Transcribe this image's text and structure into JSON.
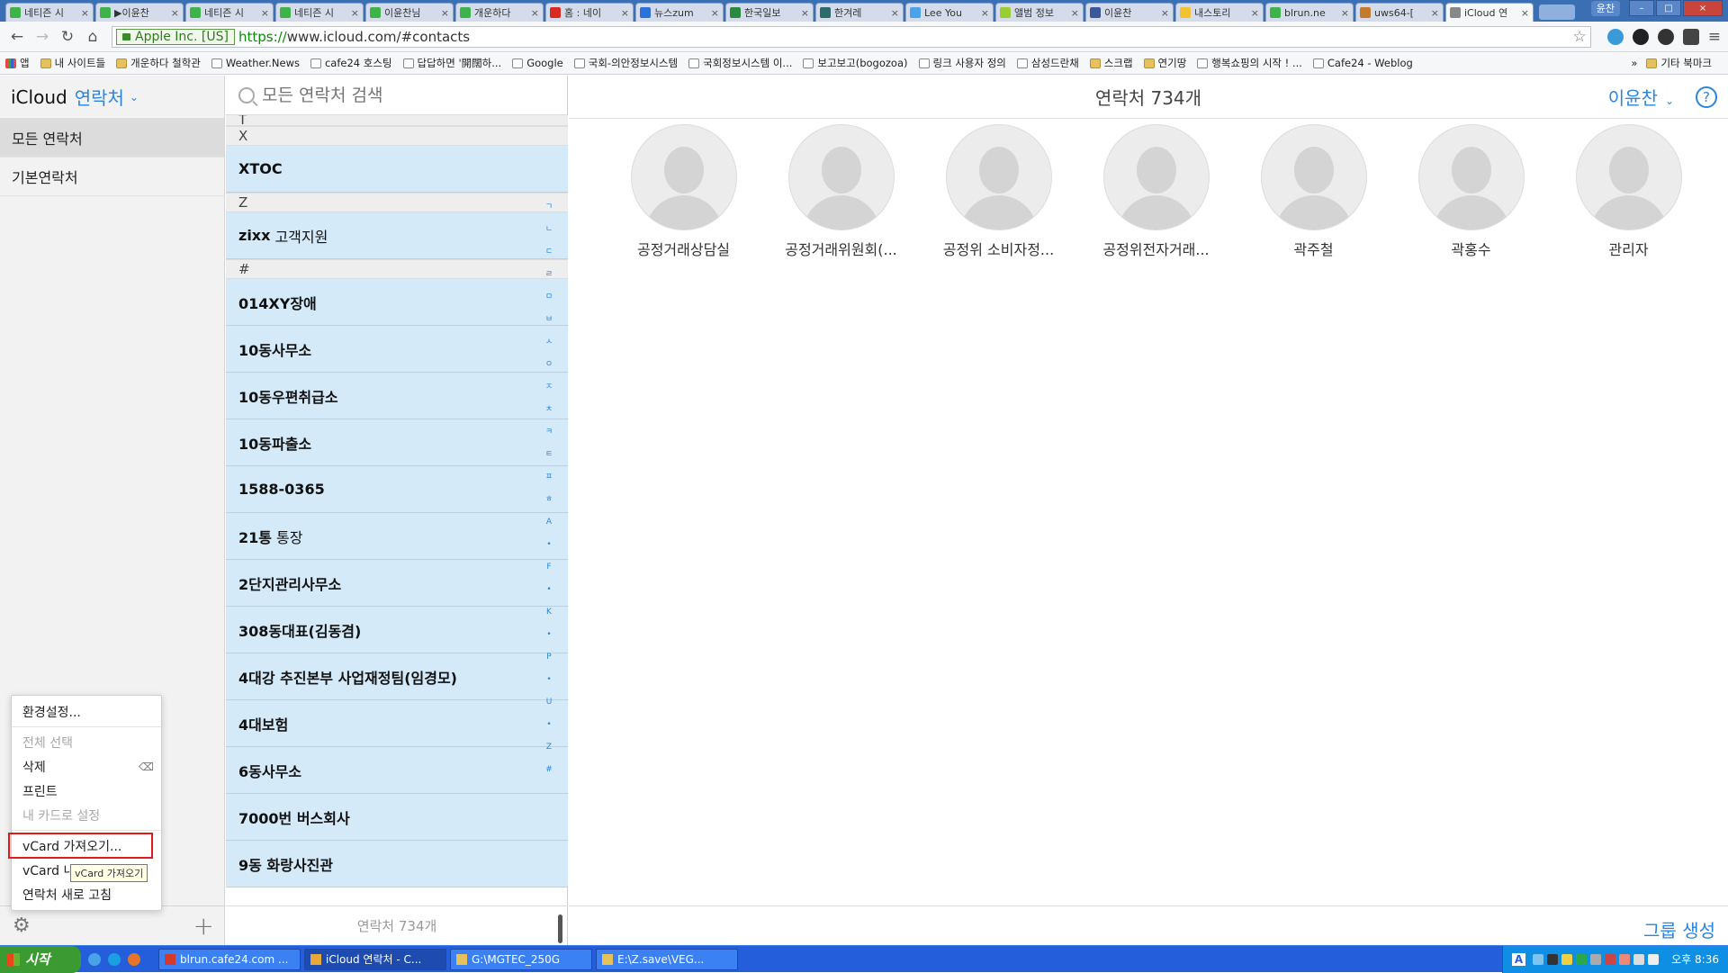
{
  "browser": {
    "tabs": [
      {
        "title": "네티즌 시",
        "color": "#3db34a",
        "active": false
      },
      {
        "title": "▶이윤찬",
        "color": "#3db34a",
        "active": false
      },
      {
        "title": "네티즌 시",
        "color": "#3db34a",
        "active": false
      },
      {
        "title": "네티즌 시",
        "color": "#3db34a",
        "active": false
      },
      {
        "title": "이윤찬님",
        "color": "#3db34a",
        "active": false
      },
      {
        "title": "개운하다",
        "color": "#3db34a",
        "active": false
      },
      {
        "title": "홈 : 네이",
        "color": "#d82a20",
        "active": false
      },
      {
        "title": "뉴스zum",
        "color": "#2b72d9",
        "active": false
      },
      {
        "title": "한국일보",
        "color": "#2a8a3e",
        "active": false
      },
      {
        "title": "한겨레",
        "color": "#2c6b6b",
        "active": false
      },
      {
        "title": "Lee You",
        "color": "#4aa3e8",
        "active": false
      },
      {
        "title": "앨범 정보",
        "color": "#9acd32",
        "active": false
      },
      {
        "title": "이윤찬",
        "color": "#3b5998",
        "active": false
      },
      {
        "title": "내스토리",
        "color": "#f2c230",
        "active": false
      },
      {
        "title": "blrun.ne",
        "color": "#3db34a",
        "active": false
      },
      {
        "title": "uws64-[",
        "color": "#c47a2c",
        "active": false
      },
      {
        "title": "iCloud 연",
        "color": "#888888",
        "active": true
      }
    ],
    "user_badge": "윤찬",
    "url": {
      "ev_label": "Apple Inc. [US]",
      "scheme": "https://",
      "rest": "www.icloud.com/#contacts"
    },
    "bookmarks": [
      {
        "label": "앱",
        "kind": "apps"
      },
      {
        "label": "내 사이트들",
        "kind": "folder"
      },
      {
        "label": "개운하다 철학관",
        "kind": "folder"
      },
      {
        "label": "Weather.News",
        "kind": "page"
      },
      {
        "label": "cafe24 호스팅",
        "kind": "page"
      },
      {
        "label": "답답하면 '開闊하...",
        "kind": "page"
      },
      {
        "label": "Google",
        "kind": "page"
      },
      {
        "label": "국회-의안정보시스템",
        "kind": "page"
      },
      {
        "label": "국회정보시스템 이...",
        "kind": "page"
      },
      {
        "label": "보고보고(bogozoa)",
        "kind": "page"
      },
      {
        "label": "링크 사용자 정의",
        "kind": "page"
      },
      {
        "label": "삼성드란채",
        "kind": "page"
      },
      {
        "label": "스크랩",
        "kind": "folder"
      },
      {
        "label": "연기땅",
        "kind": "folder"
      },
      {
        "label": "행복쇼핑의 시작 ! ...",
        "kind": "page"
      },
      {
        "label": "Cafe24 - Weblog",
        "kind": "page"
      }
    ],
    "bookmarks_more": "»",
    "other_bookmarks": "기타 북마크"
  },
  "sidebar": {
    "brand": "iCloud",
    "app": "연락처",
    "groups": [
      {
        "label": "모든 연락처",
        "selected": true
      },
      {
        "label": "기본연락처",
        "selected": false
      }
    ]
  },
  "menu": {
    "preferences": "환경설정...",
    "select_all": "전체 선택",
    "delete": "삭제",
    "delete_key": "⌫",
    "print": "프린트",
    "make_my_card": "내 카드로 설정",
    "import_vcard": "vCard 가져오기...",
    "export_vcard": "vCard 내보내기...",
    "refresh": "연락처 새로 고침",
    "tooltip": "vCard 가져오기"
  },
  "list": {
    "search_placeholder": "모든 연락처 검색",
    "top_partial_letter": "T",
    "sections": [
      {
        "letter": "X",
        "rows": [
          {
            "bold": "XTOC",
            "rest": ""
          }
        ]
      },
      {
        "letter": "Z",
        "rows": [
          {
            "bold": "zixx",
            "rest": "고객지원"
          }
        ]
      },
      {
        "letter": "#",
        "rows": [
          {
            "bold": "014XY장애",
            "rest": ""
          },
          {
            "bold": "10동사무소",
            "rest": ""
          },
          {
            "bold": "10동우편취급소",
            "rest": ""
          },
          {
            "bold": "10동파출소",
            "rest": ""
          },
          {
            "bold": "1588-0365",
            "rest": ""
          },
          {
            "bold": "21통",
            "rest": "통장"
          },
          {
            "bold": "2단지관리사무소",
            "rest": ""
          },
          {
            "bold": "308동대표(김동겸)",
            "rest": ""
          },
          {
            "bold": "4대강 추진본부 사업재정팀(임경모)",
            "rest": ""
          },
          {
            "bold": "4대보험",
            "rest": ""
          },
          {
            "bold": "6동사무소",
            "rest": ""
          },
          {
            "bold": "7000번 버스회사",
            "rest": ""
          },
          {
            "bold": "9동 화랑사진관",
            "rest": ""
          }
        ]
      }
    ],
    "index": [
      "ㄱ",
      "ㄴ",
      "ㄷ",
      "ㄹ",
      "ㅁ",
      "ㅂ",
      "ㅅ",
      "ㅇ",
      "ㅈ",
      "ㅊ",
      "ㅋ",
      "ㅌ",
      "ㅍ",
      "ㅎ",
      "A",
      "•",
      "F",
      "•",
      "K",
      "•",
      "P",
      "•",
      "U",
      "•",
      "Z",
      "#"
    ],
    "footer_count": "연락처 734개"
  },
  "main": {
    "header_count": "연락처 734개",
    "user_name": "이윤찬",
    "help": "?",
    "cards": [
      "공정거래상담실",
      "공정거래위원회(...",
      "공정위 소비자정...",
      "공정위전자거래...",
      "곽주철",
      "곽홍수",
      "관리자"
    ],
    "new_group": "그룹 생성"
  },
  "taskbar": {
    "start": "시작",
    "tasks": [
      {
        "label": "blrun.cafe24.com ...",
        "active": false,
        "color": "#d33a2c"
      },
      {
        "label": "iCloud 연락처 - C...",
        "active": true,
        "color": "#e8a93a"
      },
      {
        "label": "G:\\MGTEC_250G",
        "active": false,
        "color": "#e7c25c"
      },
      {
        "label": "E:\\Z.save\\VEG...",
        "active": false,
        "color": "#e7c25c"
      }
    ],
    "ime": "A",
    "clock": "오후 8:36"
  },
  "colors": {
    "accent": "#2a84e0",
    "row_selected": "#d5eaf9",
    "highlight_box": "#e01b1b"
  }
}
